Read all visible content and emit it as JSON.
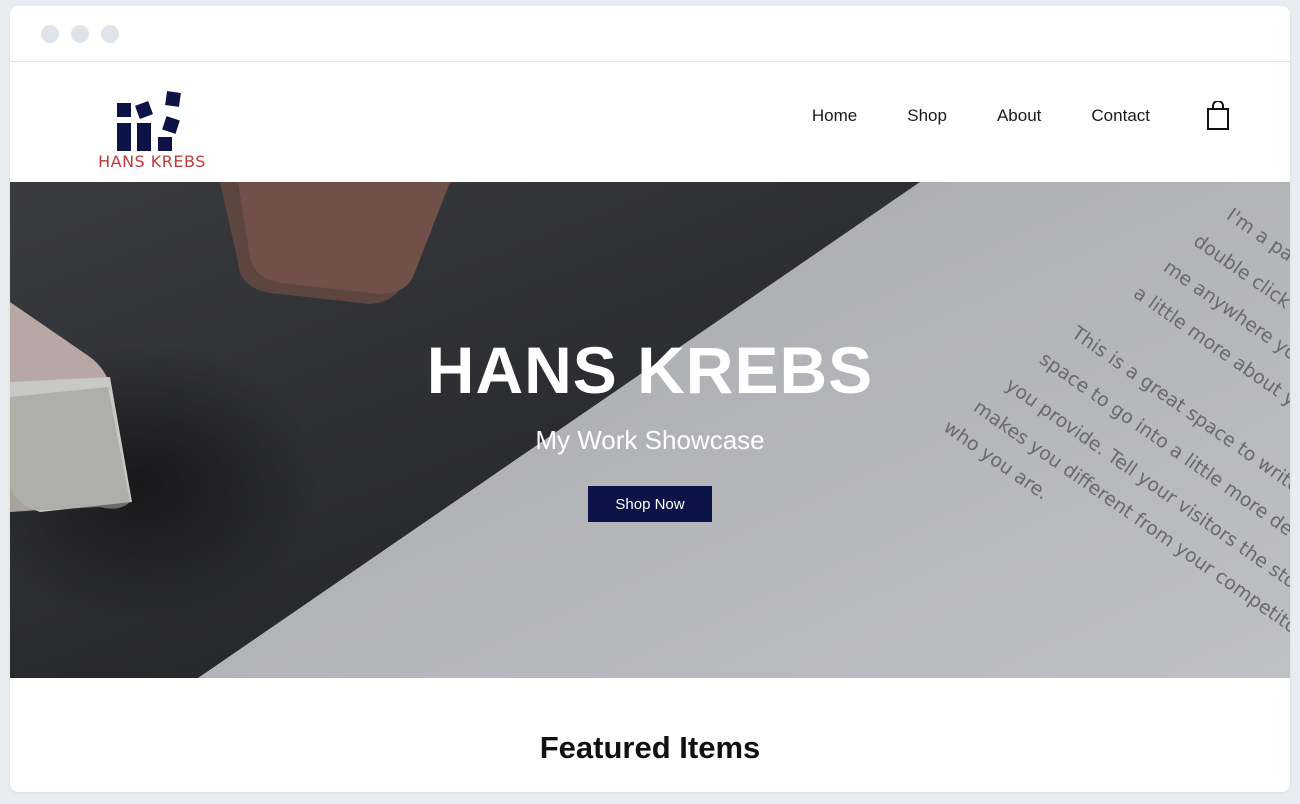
{
  "brand": {
    "logo_text": "HANS KREBS",
    "logo_color": "#0e1347",
    "logo_text_color": "#c0393b"
  },
  "nav": {
    "items": [
      {
        "label": "Home"
      },
      {
        "label": "Shop"
      },
      {
        "label": "About"
      },
      {
        "label": "Contact"
      }
    ],
    "cart_icon": "shopping-bag-icon"
  },
  "hero": {
    "title": "HANS KREBS",
    "subtitle": "My Work Showcase",
    "button_label": "Shop Now",
    "button_color": "#0e1347",
    "paper_lines": [
      "I'm a pa",
      "double click",
      "me anywhere you",
      "a little more about yo",
      "This is a great space to write lo",
      "space to go into a little more detai",
      "you provide. Tell your visitors the story o",
      "makes you different from your competitors. M",
      "who you are."
    ]
  },
  "section": {
    "featured_title": "Featured Items"
  }
}
